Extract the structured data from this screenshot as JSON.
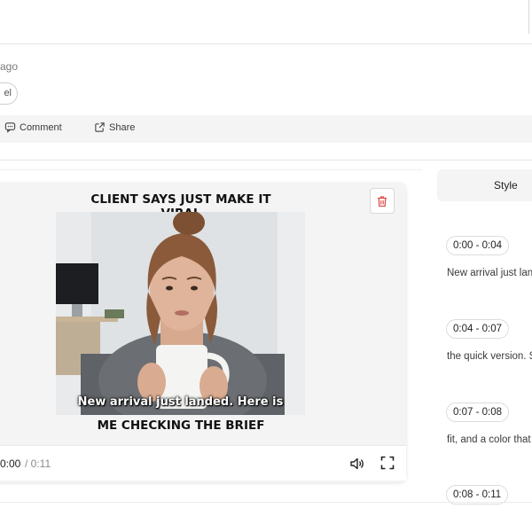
{
  "post": {
    "time_ago": "ago",
    "tag": "el"
  },
  "actions": {
    "comment_label": "Comment",
    "share_label": "Share"
  },
  "video": {
    "meme_top_text": "CLIENT SAYS JUST MAKE IT VIRAL",
    "caption": "New arrival just landed. Here is",
    "meme_bottom_text": "ME CHECKING THE BRIEF",
    "time_current": "0:00",
    "time_total": "/ 0:11"
  },
  "sidebar": {
    "style_tab_label": "Style",
    "segments": [
      {
        "range": "0:00 - 0:04",
        "text": "New arrival just lan"
      },
      {
        "range": "0:04 - 0:07",
        "text": "the quick version. S"
      },
      {
        "range": "0:07 - 0:08",
        "text": "fit, and a color that"
      },
      {
        "range": "0:08 - 0:11",
        "text": ""
      }
    ]
  },
  "colors": {
    "delete_icon": "#d9534f",
    "panel_bg": "#f4f4f4"
  }
}
